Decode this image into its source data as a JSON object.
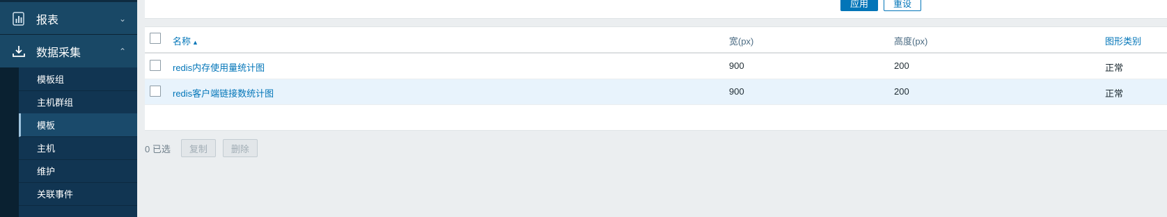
{
  "sidebar": {
    "report": {
      "label": "报表",
      "icon": "report-icon"
    },
    "datacollect": {
      "label": "数据采集",
      "icon": "download-icon"
    },
    "items": [
      {
        "label": "模板组"
      },
      {
        "label": "主机群组"
      },
      {
        "label": "模板"
      },
      {
        "label": "主机"
      },
      {
        "label": "维护"
      },
      {
        "label": "关联事件"
      }
    ]
  },
  "filter": {
    "apply_label": "应用",
    "reset_label": "重设"
  },
  "table": {
    "headers": {
      "name": "名称",
      "width": "宽(px)",
      "height": "高度(px)",
      "type": "图形类别"
    },
    "rows": [
      {
        "name": "redis内存使用量统计图",
        "width": "900",
        "height": "200",
        "type": "正常"
      },
      {
        "name": "redis客户端链接数统计图",
        "width": "900",
        "height": "200",
        "type": "正常"
      }
    ]
  },
  "footer": {
    "selected": "0 已选",
    "copy_label": "复制",
    "delete_label": "删除"
  },
  "colors": {
    "sidebar_bg": "#0e2b40",
    "accent": "#0275b8",
    "row_highlight": "#e8f3fc"
  }
}
